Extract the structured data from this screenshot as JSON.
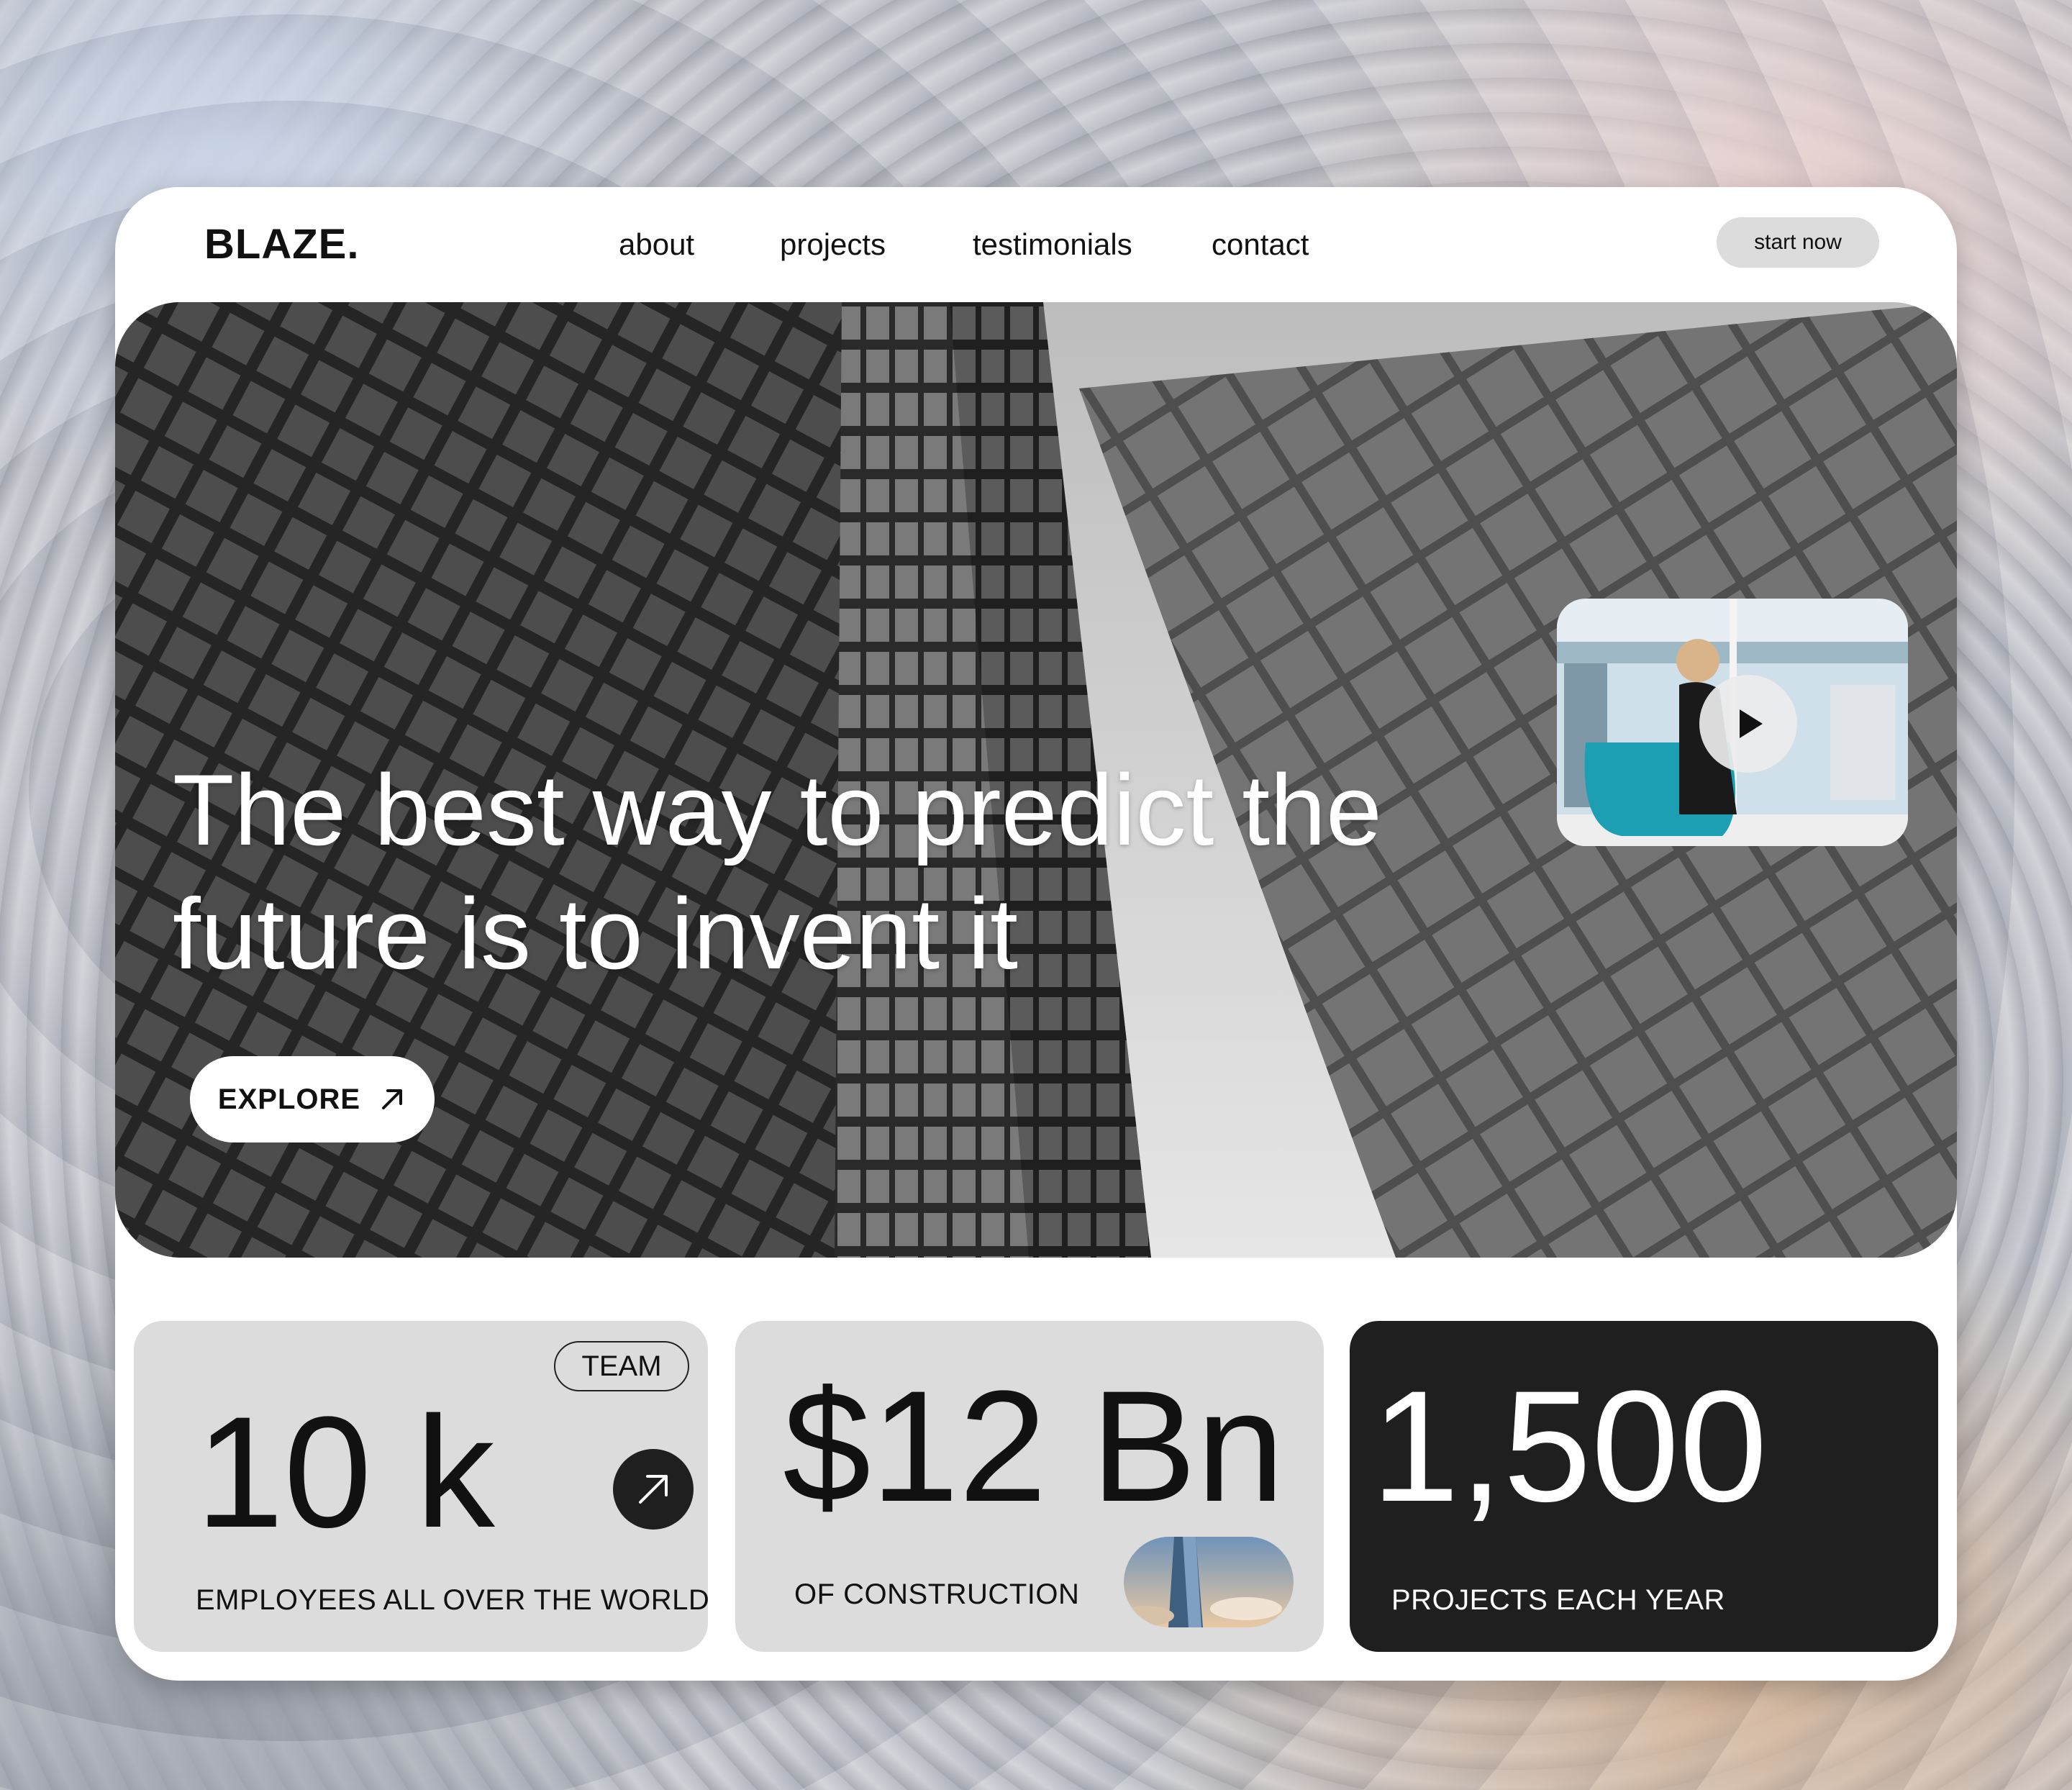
{
  "brand": {
    "logo": "BLAZE."
  },
  "nav": {
    "links": [
      "about",
      "projects",
      "testimonials",
      "contact"
    ],
    "cta": "start now"
  },
  "hero": {
    "headline_line1": "The best way to predict the",
    "headline_line2": "future is to invent it",
    "explore_label": "EXPLORE",
    "video": {
      "icon": "play-icon"
    }
  },
  "stats": [
    {
      "value": "10 k",
      "caption": "EMPLOYEES ALL OVER THE WORLD",
      "badge": "TEAM",
      "icon": "arrow-up-right-icon"
    },
    {
      "value": "$12 Bn",
      "caption": "OF CONSTRUCTION"
    },
    {
      "value": "1,500",
      "caption": "PROJECTS EACH YEAR"
    }
  ],
  "colors": {
    "card_bg": "#ffffff",
    "stat_light": "#dcdcdc",
    "stat_dark": "#1f1f1f",
    "text_dark": "#111111",
    "text_light": "#ffffff"
  }
}
